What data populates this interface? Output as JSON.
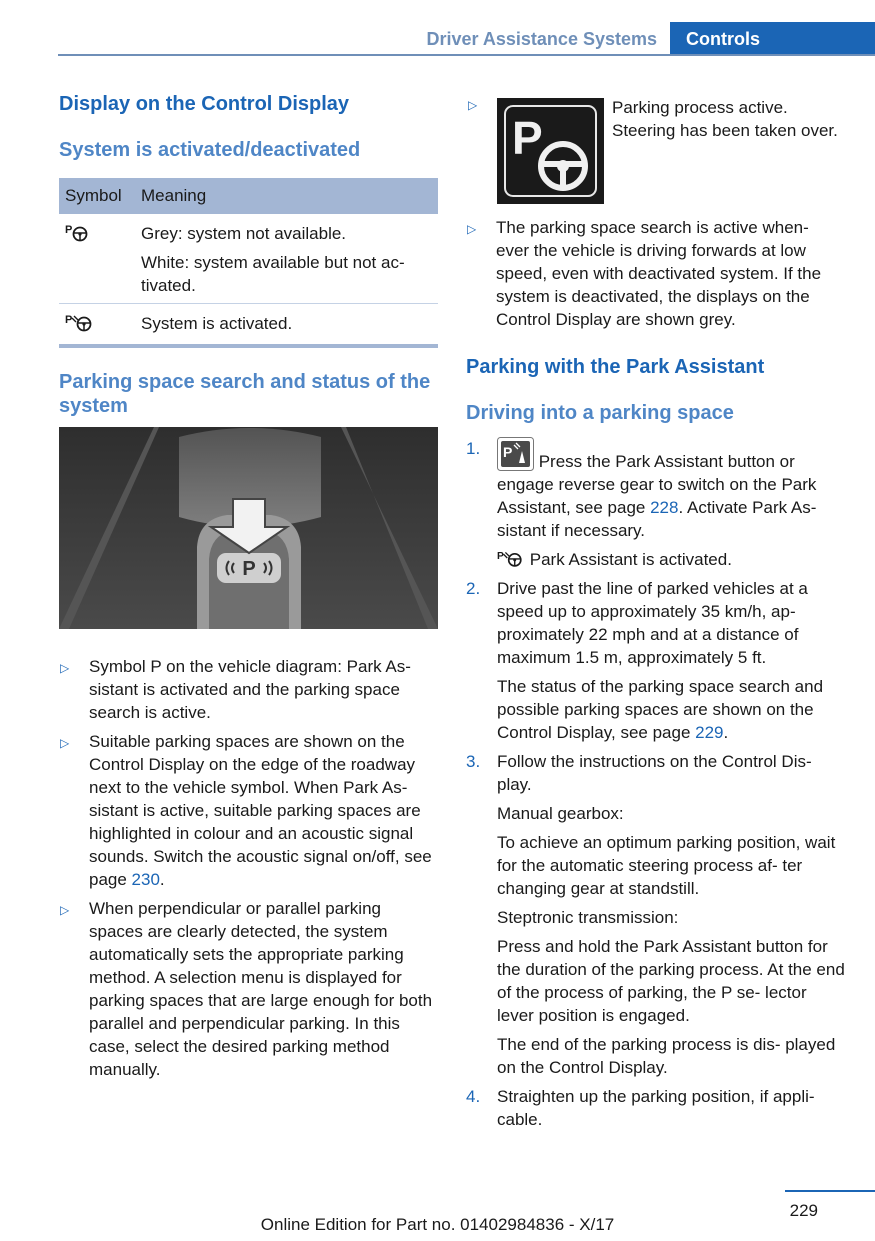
{
  "header": {
    "section": "Driver Assistance Systems",
    "tab": "Controls"
  },
  "left": {
    "heading1": "Display on the Control Display",
    "heading2": "System is activated/deactivated",
    "table": {
      "col_symbol": "Symbol",
      "col_meaning": "Meaning",
      "row1_meaning_a": "Grey: system not available.",
      "row1_meaning_b": "White: system available but not ac- tivated.",
      "row2_meaning": "System is activated."
    },
    "heading3": "Parking space search and status of the system",
    "bullet1": "Symbol P on the vehicle diagram: Park As- sistant is activated and the parking space search is active.",
    "bullet2_text": "Suitable parking spaces are shown on the Control Display on the edge of the roadway next to the vehicle symbol. When Park As- sistant is active, suitable parking spaces are highlighted in colour and an acoustic signal sounds. Switch the acoustic signal on/off, see page ",
    "bullet2_link": "230",
    "bullet2_end": ".",
    "bullet3": "When perpendicular or parallel parking spaces are clearly detected, the system automatically sets the appropriate parking method. A selection menu is displayed for parking spaces that are large enough for both parallel and perpendicular parking. In this case, select the desired parking method manually.",
    "pict_label": "P"
  },
  "right": {
    "bullet1": "Parking process active. Steering has been taken over.",
    "bullet1_icon_letter": "P",
    "bullet2": "The parking space search is active when- ever the vehicle is driving forwards at low speed, even with deactivated system. If the system is deactivated, the displays on the Control Display are shown grey.",
    "heading1": "Parking with the Park Assistant",
    "heading2": "Driving into a parking space",
    "steps": [
      {
        "num": "1."
      },
      {
        "num": "2."
      },
      {
        "num": "3."
      },
      {
        "num": "4."
      }
    ],
    "step1_text": " Press the Park Assistant button or engage reverse gear to switch on the Park Assistant, see page ",
    "step1_link": "228",
    "step1_end": ". Activate Park As- sistant if necessary.",
    "step1_note": "Park Assistant is activated.",
    "step2_a": "Drive past the line of parked vehicles at a speed up to approximately 35 km/h, ap- proximately 22 mph and at a distance of maximum 1.5 m, approximately 5 ft.",
    "step2_b_text": "The status of the parking space search and possible parking spaces are shown on the Control Display, see page ",
    "step2_b_link": "229",
    "step2_b_end": ".",
    "step3_a": "Follow the instructions on the Control Dis- play.",
    "step3_b": "Manual gearbox:",
    "step3_c": "To achieve an optimum parking position, wait for the automatic steering process af- ter changing gear at standstill.",
    "step3_d": "Steptronic transmission:",
    "step3_e": "Press and hold the Park Assistant button for the duration of the parking process. At the end of the process of parking, the P se- lector lever position is engaged.",
    "step3_f": "The end of the parking process is dis- played on the Control Display.",
    "step4": "Straighten up the parking position, if appli- cable."
  },
  "footer": {
    "edition": "Online Edition for Part no. 01402984836 - X/17",
    "page": "229"
  },
  "colors": {
    "accent": "#1b65b5",
    "header_text": "#6f8fb8",
    "table_head": "#a3b6d4"
  },
  "icons": [
    "park-assist-inactive-icon",
    "park-assist-active-icon",
    "steering-wheel-icon",
    "park-assist-button-icon",
    "bullet-triangle-icon"
  ]
}
